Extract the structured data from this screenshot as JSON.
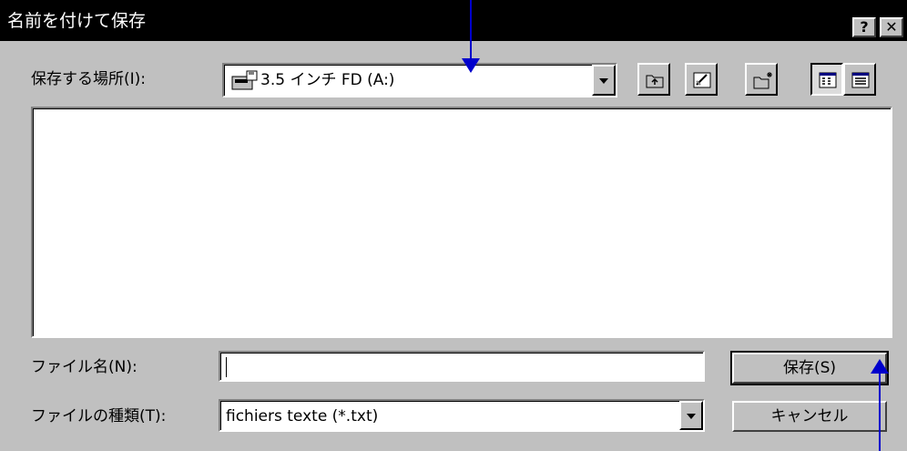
{
  "dialog": {
    "title": "名前を付けて保存",
    "help_button": "?",
    "close_button": "✕"
  },
  "location": {
    "label": "保存する場所(I):",
    "value": "3.5 インチ FD (A:)",
    "icon": "floppy-drive-icon"
  },
  "toolbar": {
    "icons": [
      "up-one-level-icon",
      "desktop-icon",
      "new-folder-icon",
      "list-view-icon",
      "details-view-icon"
    ]
  },
  "file_list": {
    "items": []
  },
  "filename": {
    "label": "ファイル名(N):",
    "value": ""
  },
  "filetype": {
    "label": "ファイルの種類(T):",
    "value": "fichiers texte (*.txt)"
  },
  "buttons": {
    "save": "保存(S)",
    "cancel": "キャンセル"
  },
  "colors": {
    "titlebar": "#000000",
    "dialog_bg": "#c0c0c0",
    "annotation_arrow": "#0000cc"
  }
}
